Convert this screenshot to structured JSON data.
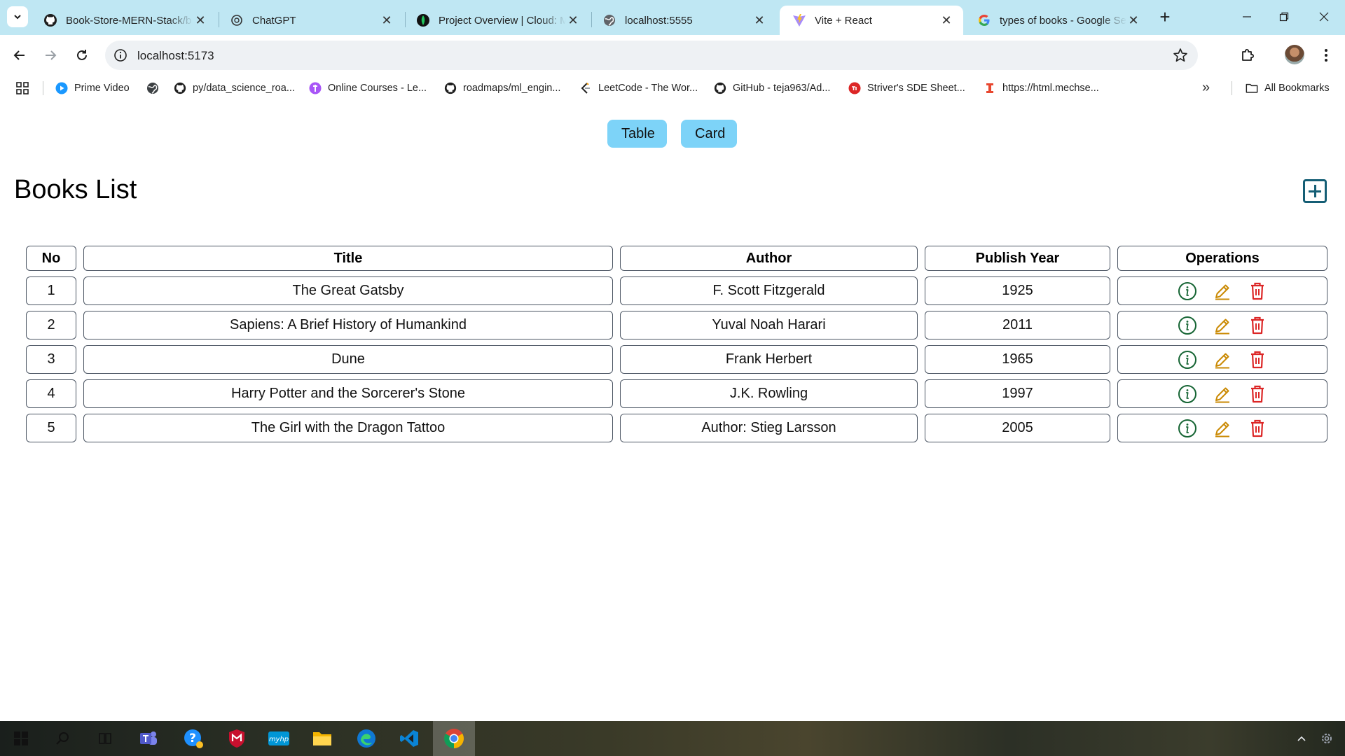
{
  "browser": {
    "tabs": [
      {
        "title": "Book-Store-MERN-Stack/b",
        "icon": "github-icon",
        "active": false
      },
      {
        "title": "ChatGPT",
        "icon": "chatgpt-icon",
        "active": false
      },
      {
        "title": "Project Overview | Cloud: M",
        "icon": "mongodb-icon",
        "active": false
      },
      {
        "title": "localhost:5555",
        "icon": "globe-icon",
        "active": false
      },
      {
        "title": "Vite + React",
        "icon": "vite-icon",
        "active": true
      },
      {
        "title": "types of books - Google Se",
        "icon": "google-icon",
        "active": false
      }
    ],
    "address": "localhost:5173",
    "bookmarks": [
      {
        "label": "Prime Video",
        "icon": "prime-video-icon"
      },
      {
        "label": "",
        "icon": "globe-icon"
      },
      {
        "label": "py/data_science_roa...",
        "icon": "github-icon"
      },
      {
        "label": "Online Courses - Le...",
        "icon": "courses-icon"
      },
      {
        "label": "roadmaps/ml_engin...",
        "icon": "github-icon"
      },
      {
        "label": "LeetCode - The Wor...",
        "icon": "leetcode-icon"
      },
      {
        "label": "GitHub - teja963/Ad...",
        "icon": "github-icon"
      },
      {
        "label": "Striver's SDE Sheet...",
        "icon": "tuf-icon"
      },
      {
        "label": "https://html.mechse...",
        "icon": "mechse-icon"
      }
    ],
    "all_bookmarks": "All Bookmarks"
  },
  "page": {
    "toggles": {
      "table": "Table",
      "card": "Card"
    },
    "title": "Books List",
    "table": {
      "headers": [
        "No",
        "Title",
        "Author",
        "Publish Year",
        "Operations"
      ],
      "rows": [
        {
          "no": "1",
          "title": "The Great Gatsby",
          "author": "F. Scott Fitzgerald",
          "year": "1925"
        },
        {
          "no": "2",
          "title": "Sapiens: A Brief History of Humankind",
          "author": "Yuval Noah Harari",
          "year": "2011"
        },
        {
          "no": "3",
          "title": "Dune",
          "author": "Frank Herbert",
          "year": "1965"
        },
        {
          "no": "4",
          "title": "Harry Potter and the Sorcerer's Stone",
          "author": "J.K. Rowling",
          "year": "1997"
        },
        {
          "no": "5",
          "title": "The Girl with the Dragon Tattoo",
          "author": "Author: Stieg Larsson",
          "year": "2005"
        }
      ]
    },
    "colors": {
      "info": "#166534",
      "edit": "#ca8a04",
      "delete": "#dc2626",
      "toggle_bg": "#7dd3f8",
      "add": "#155e75"
    }
  }
}
